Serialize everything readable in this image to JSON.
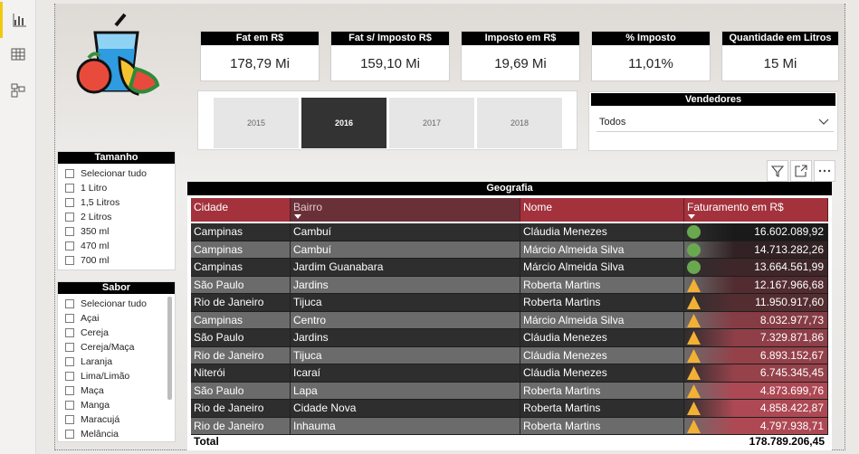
{
  "rail": {
    "items": [
      {
        "icon": "report-view-icon",
        "active": true
      },
      {
        "icon": "data-view-icon",
        "active": false
      },
      {
        "icon": "model-view-icon",
        "active": false
      }
    ]
  },
  "kpis": [
    {
      "title": "Fat em R$",
      "value": "178,79 Mi"
    },
    {
      "title": "Fat s/ Imposto R$",
      "value": "159,10 Mi"
    },
    {
      "title": "Imposto em R$",
      "value": "19,69 Mi"
    },
    {
      "title": "% Imposto",
      "value": "11,01%"
    },
    {
      "title": "Quantidade em Litros",
      "value": "15 Mi"
    }
  ],
  "years": {
    "options": [
      "2015",
      "2016",
      "2017",
      "2018"
    ],
    "selected": "2016"
  },
  "vendedores": {
    "title": "Vendedores",
    "value": "Todos"
  },
  "tamanho": {
    "title": "Tamanho",
    "options": [
      "Selecionar tudo",
      "1 Litro",
      "1,5 Litros",
      "2 Litros",
      "350 ml",
      "470 ml",
      "700 ml"
    ]
  },
  "sabor": {
    "title": "Sabor",
    "options": [
      "Selecionar tudo",
      "Açai",
      "Cereja",
      "Cereja/Maça",
      "Laranja",
      "Lima/Limão",
      "Maça",
      "Manga",
      "Maracujá",
      "Melância"
    ]
  },
  "table": {
    "title": "Geografia",
    "headers": [
      "Cidade",
      "Bairro",
      "Nome",
      "Faturamento em R$"
    ],
    "header_colors": [
      "#a3323d",
      "#6a3038",
      "#a3323d",
      "#a3323d"
    ],
    "rows": [
      {
        "cidade": "Campinas",
        "bairro": "Cambuí",
        "nome": "Cláudia Menezes",
        "valor": "16.602.089,92",
        "indicator": "circle",
        "fill": 1.0
      },
      {
        "cidade": "Campinas",
        "bairro": "Cambuí",
        "nome": "Márcio Almeida Silva",
        "valor": "14.713.282,26",
        "indicator": "circle",
        "fill": 0.886
      },
      {
        "cidade": "Campinas",
        "bairro": "Jardim Guanabara",
        "nome": "Márcio Almeida Silva",
        "valor": "13.664.561,99",
        "indicator": "circle",
        "fill": 0.823
      },
      {
        "cidade": "São Paulo",
        "bairro": "Jardins",
        "nome": "Roberta Martins",
        "valor": "12.167.966,68",
        "indicator": "triangle",
        "fill": 0.733
      },
      {
        "cidade": "Rio de Janeiro",
        "bairro": "Tijuca",
        "nome": "Roberta Martins",
        "valor": "11.950.917,60",
        "indicator": "triangle",
        "fill": 0.72
      },
      {
        "cidade": "Campinas",
        "bairro": "Centro",
        "nome": "Márcio Almeida Silva",
        "valor": "8.032.977,73",
        "indicator": "triangle",
        "fill": 0.484
      },
      {
        "cidade": "São Paulo",
        "bairro": "Jardins",
        "nome": "Cláudia Menezes",
        "valor": "7.329.871,86",
        "indicator": "triangle",
        "fill": 0.441
      },
      {
        "cidade": "Rio de Janeiro",
        "bairro": "Tijuca",
        "nome": "Cláudia Menezes",
        "valor": "6.893.152,67",
        "indicator": "triangle",
        "fill": 0.415
      },
      {
        "cidade": "Niterói",
        "bairro": "Icaraí",
        "nome": "Cláudia Menezes",
        "valor": "6.745.345,45",
        "indicator": "triangle",
        "fill": 0.406
      },
      {
        "cidade": "São Paulo",
        "bairro": "Lapa",
        "nome": "Roberta Martins",
        "valor": "4.873.699,76",
        "indicator": "triangle",
        "fill": 0.294
      },
      {
        "cidade": "Rio de Janeiro",
        "bairro": "Cidade Nova",
        "nome": "Roberta Martins",
        "valor": "4.858.422,87",
        "indicator": "triangle",
        "fill": 0.293
      },
      {
        "cidade": "Rio de Janeiro",
        "bairro": "Inhauma",
        "nome": "Roberta Martins",
        "valor": "4.797.938,71",
        "indicator": "triangle",
        "fill": 0.289
      }
    ],
    "total_label": "Total",
    "total_value": "178.789.206,45"
  },
  "colors": {
    "row_dark": "#2e2e2e",
    "row_light": "#6b6b6b",
    "circle": "#6aa84f",
    "triangle": "#f2b134",
    "value_high": "#1a1a1a",
    "value_low": "#b04a55"
  }
}
